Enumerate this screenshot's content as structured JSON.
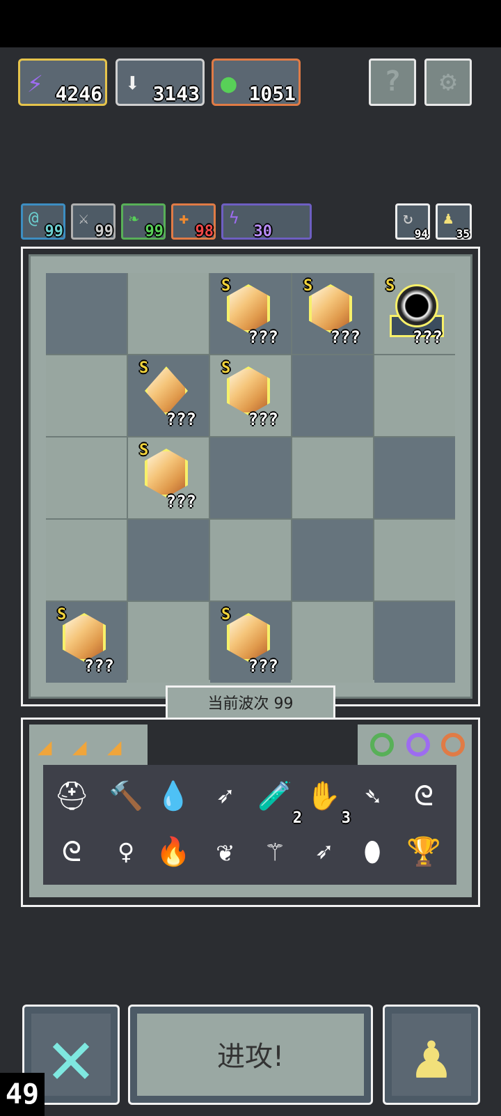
{
  "resources": [
    {
      "icon": "lightning-icon",
      "value": "4246",
      "color": "#9d6cf0",
      "border": "#e6c44c"
    },
    {
      "icon": "down-arrow-icon",
      "value": "3143",
      "color": "#f2f2f2",
      "border": "#d0d0d0"
    },
    {
      "icon": "slime-icon",
      "value": "1051",
      "color": "#58d058",
      "border": "#e07b46"
    }
  ],
  "buttons": {
    "help": "?",
    "settings": "⚙"
  },
  "stats": [
    {
      "icon": "at-icon",
      "value": "99"
    },
    {
      "icon": "sword-icon",
      "value": "99"
    },
    {
      "icon": "leaf-icon",
      "value": "99"
    },
    {
      "icon": "plus-icon",
      "value": "98"
    },
    {
      "icon": "bolt-icon",
      "value": "30"
    }
  ],
  "right_stats": [
    {
      "icon": "refresh-icon",
      "value": "94"
    },
    {
      "icon": "pawn-icon",
      "value": "35"
    }
  ],
  "board": {
    "items": [
      {
        "row": 0,
        "col": 2,
        "kind": "gem",
        "rank": "S",
        "label": "???"
      },
      {
        "row": 0,
        "col": 3,
        "kind": "gem",
        "rank": "S",
        "label": "???"
      },
      {
        "row": 0,
        "col": 4,
        "kind": "portal",
        "rank": "S",
        "label": "???"
      },
      {
        "row": 1,
        "col": 1,
        "kind": "diamond",
        "rank": "S",
        "label": "???"
      },
      {
        "row": 1,
        "col": 2,
        "kind": "gem",
        "rank": "S",
        "label": "???"
      },
      {
        "row": 2,
        "col": 1,
        "kind": "gem",
        "rank": "S",
        "label": "???"
      },
      {
        "row": 4,
        "col": 0,
        "kind": "gem",
        "rank": "S",
        "label": "???"
      },
      {
        "row": 4,
        "col": 2,
        "kind": "gem",
        "rank": "S",
        "label": "???"
      }
    ]
  },
  "wave_label": "当前波次 99",
  "inventory": {
    "rings": [
      "#58b058",
      "#9d6cf0",
      "#e07b46"
    ],
    "row1": [
      {
        "icon": "helmet-icon",
        "glyph": "⛑",
        "count": ""
      },
      {
        "icon": "hammer-icon",
        "glyph": "🔨",
        "count": ""
      },
      {
        "icon": "water-drop-icon",
        "glyph": "💧",
        "count": ""
      },
      {
        "icon": "green-arrow-icon",
        "glyph": "➶",
        "count": ""
      },
      {
        "icon": "potion-icon",
        "glyph": "🧪",
        "count": "2"
      },
      {
        "icon": "claw-icon",
        "glyph": "✋",
        "count": "3"
      },
      {
        "icon": "red-arrow-icon",
        "glyph": "➴",
        "count": ""
      },
      {
        "icon": "blue-swirl-icon",
        "glyph": "ᘓ",
        "count": ""
      }
    ],
    "row2": [
      {
        "icon": "purple-swirl-icon",
        "glyph": "ᘓ",
        "count": ""
      },
      {
        "icon": "key-icon",
        "glyph": "♀",
        "count": ""
      },
      {
        "icon": "fire-icon",
        "glyph": "🔥",
        "count": ""
      },
      {
        "icon": "vine-icon",
        "glyph": "❦",
        "count": ""
      },
      {
        "icon": "wand-icon",
        "glyph": "⚚",
        "count": ""
      },
      {
        "icon": "pink-arrow-icon",
        "glyph": "➶",
        "count": ""
      },
      {
        "icon": "mirror-icon",
        "glyph": "⬮",
        "count": ""
      },
      {
        "icon": "chalice-icon",
        "glyph": "🏆",
        "count": ""
      }
    ]
  },
  "attack_label": "进攻!",
  "fps": "49"
}
